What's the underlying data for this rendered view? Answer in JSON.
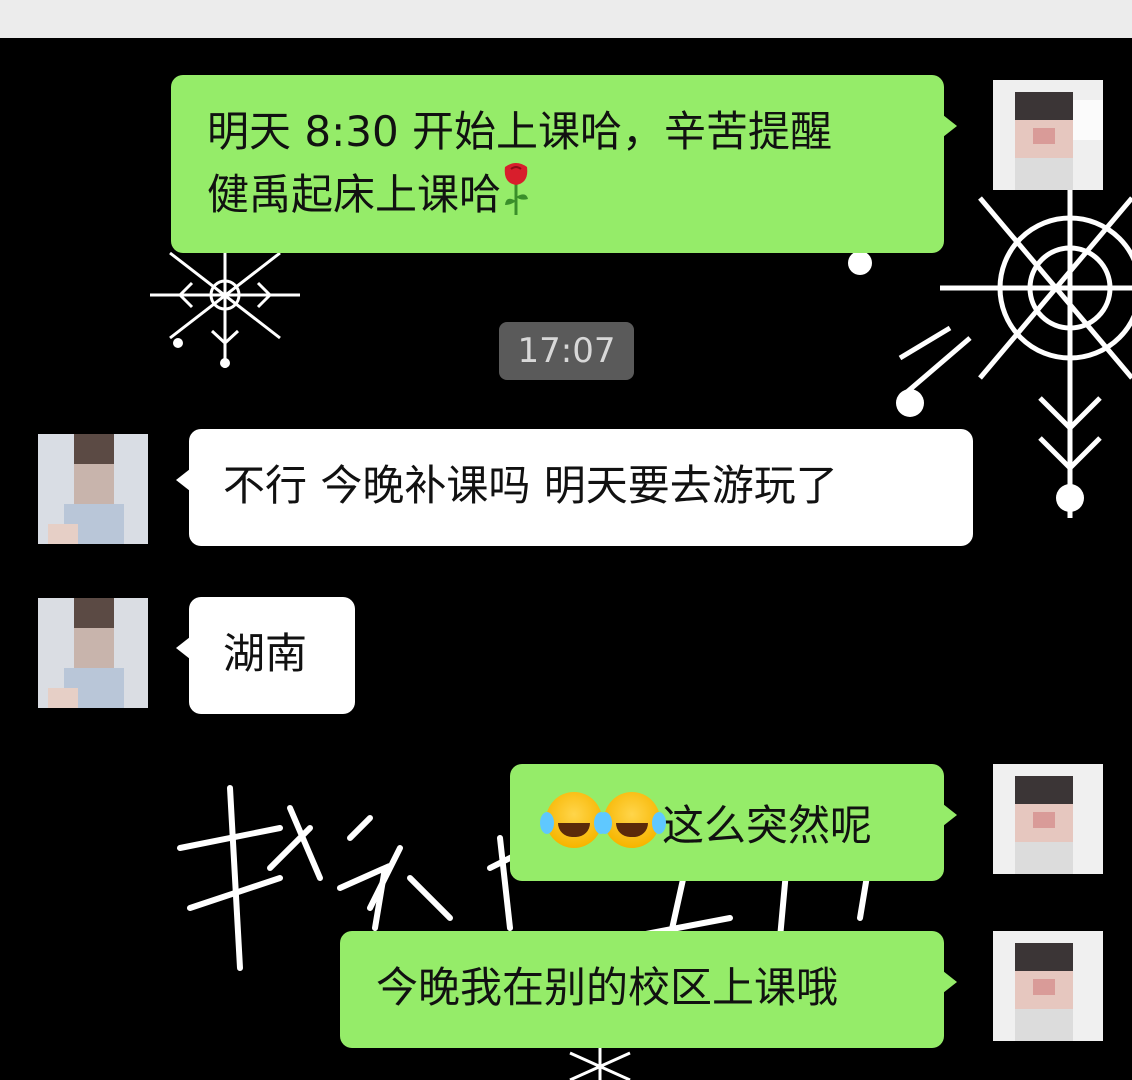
{
  "messages": [
    {
      "side": "out",
      "text": "明天 8:30 开始上课哈，辛苦提醒",
      "text2": "健禹起床上课哈",
      "emoji": "rose-icon"
    },
    {
      "side": "in",
      "text": "不行 今晚补课吗  明天要去游玩了"
    },
    {
      "side": "in",
      "text": "湖南"
    },
    {
      "side": "out",
      "text": "这么突然呢",
      "emoji": "laughing-tears-icon"
    },
    {
      "side": "out",
      "text": "今晚我在别的校区上课哦"
    }
  ],
  "timestamp": "17:07",
  "colors": {
    "background": "#000000",
    "outgoing_bubble": "#95ec69",
    "incoming_bubble": "#ffffff",
    "timestamp_bg": "#5a5a5a"
  }
}
